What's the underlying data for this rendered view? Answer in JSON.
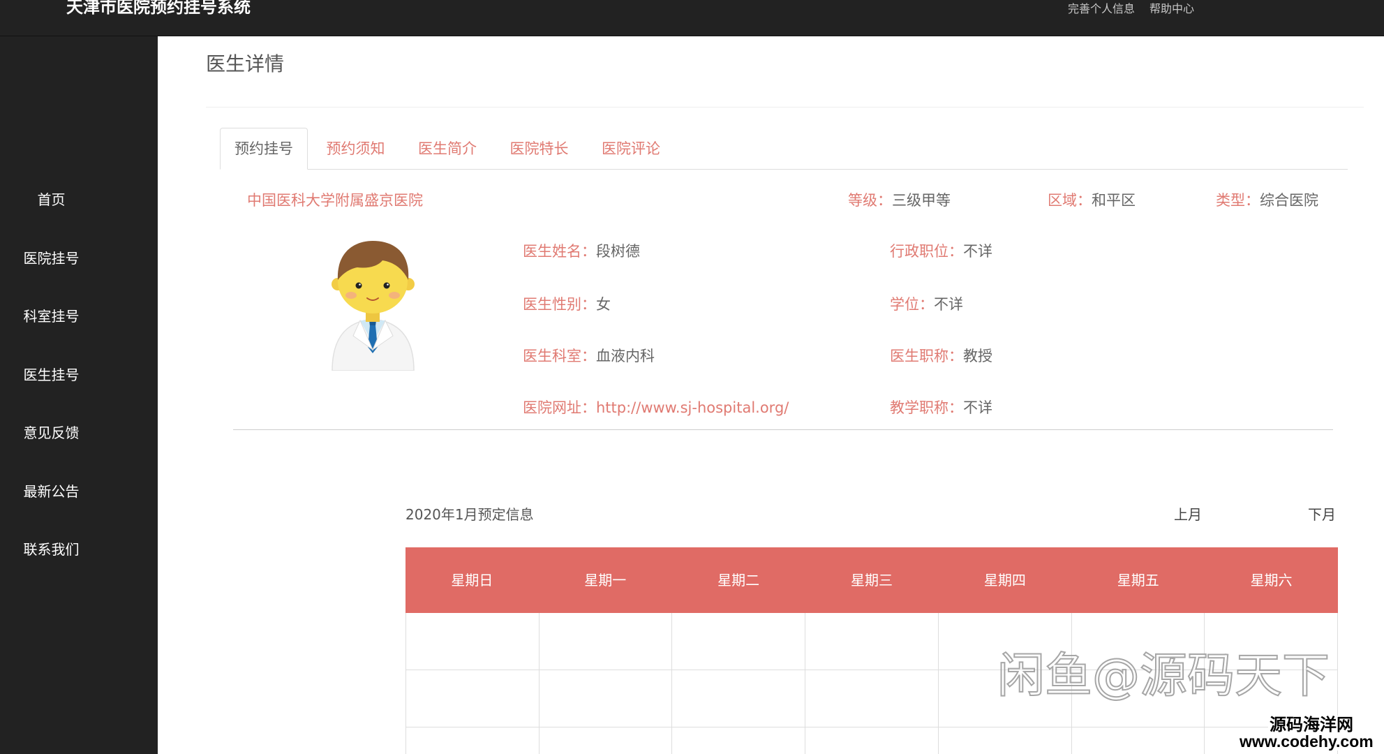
{
  "app": {
    "title": "天津市医院预约挂号系统",
    "top_links": [
      "完善个人信息",
      "帮助中心"
    ]
  },
  "sidebar": {
    "items": [
      "首页",
      "医院挂号",
      "科室挂号",
      "医生挂号",
      "意见反馈",
      "最新公告",
      "联系我们"
    ]
  },
  "page": {
    "title": "医生详情"
  },
  "tabs": [
    {
      "label": "预约挂号",
      "active": true
    },
    {
      "label": "预约须知",
      "active": false
    },
    {
      "label": "医生简介",
      "active": false
    },
    {
      "label": "医院特长",
      "active": false
    },
    {
      "label": "医院评论",
      "active": false
    }
  ],
  "hospital": {
    "name": "中国医科大学附属盛京医院",
    "level": {
      "label": "等级：",
      "value": "三级甲等"
    },
    "area": {
      "label": "区域：",
      "value": "和平区"
    },
    "type": {
      "label": "类型：",
      "value": "综合医院"
    }
  },
  "doctor": {
    "avatar_icon": "doctor-avatar-icon",
    "left": [
      {
        "label": "医生姓名：",
        "value": "段树德"
      },
      {
        "label": "医生性别：",
        "value": "女"
      },
      {
        "label": "医生科室：",
        "value": "血液内科"
      },
      {
        "label": "医院网址：",
        "value": "http://www.sj-hospital.org/"
      }
    ],
    "right": [
      {
        "label": "行政职位：",
        "value": "不详"
      },
      {
        "label": "学位：",
        "value": "不详"
      },
      {
        "label": "医生职称：",
        "value": "教授"
      },
      {
        "label": "教学职称：",
        "value": "不详"
      }
    ]
  },
  "calendar": {
    "title": "2020年1月预定信息",
    "prev": "上月",
    "next": "下月",
    "weekdays": [
      "星期日",
      "星期一",
      "星期二",
      "星期三",
      "星期四",
      "星期五",
      "星期六"
    ]
  },
  "watermark": {
    "text": "闲鱼@源码天下",
    "site_name": "源码海洋网",
    "site_url": "www.codehy.com"
  },
  "colors": {
    "accent": "#e07a72",
    "calendar_head": "#e06b65",
    "dark": "#222222",
    "text": "#666666",
    "title": "#555555"
  }
}
